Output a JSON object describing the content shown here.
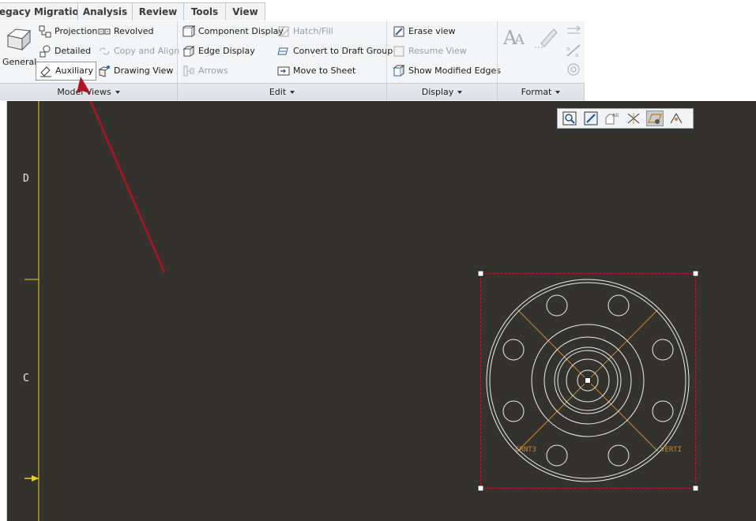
{
  "tabs": [
    {
      "label": "egacy Migration"
    },
    {
      "label": "Analysis"
    },
    {
      "label": "Review"
    },
    {
      "label": "Tools"
    },
    {
      "label": "View"
    }
  ],
  "ribbon": {
    "model_views": {
      "general": "General",
      "projection": "Projection",
      "revolved": "Revolved",
      "detailed": "Detailed",
      "copy_align": "Copy and Align",
      "auxiliary": "Auxiliary",
      "drawing_view": "Drawing View",
      "footer": "Model Views"
    },
    "edit": {
      "component_display": "Component Display",
      "hatch_fill": "Hatch/Fill",
      "edge_display": "Edge Display",
      "convert_draft": "Convert to Draft Group",
      "arrows": "Arrows",
      "move_sheet": "Move to Sheet",
      "footer": "Edit"
    },
    "display": {
      "erase_view": "Erase view",
      "resume_view": "Resume View",
      "show_modified": "Show Modified Edges",
      "footer": "Display"
    },
    "format": {
      "footer": "Format"
    }
  },
  "drawing": {
    "zone_d": "D",
    "zone_c": "C",
    "label_left": "CRNT3",
    "label_right": "VERTI"
  },
  "colors": {
    "canvas_bg": "#33322d",
    "border_yellow": "#e6d21a",
    "selection_red": "#d2142c",
    "annotation_arrow": "#b0141e",
    "center_line": "#c98a2e"
  }
}
